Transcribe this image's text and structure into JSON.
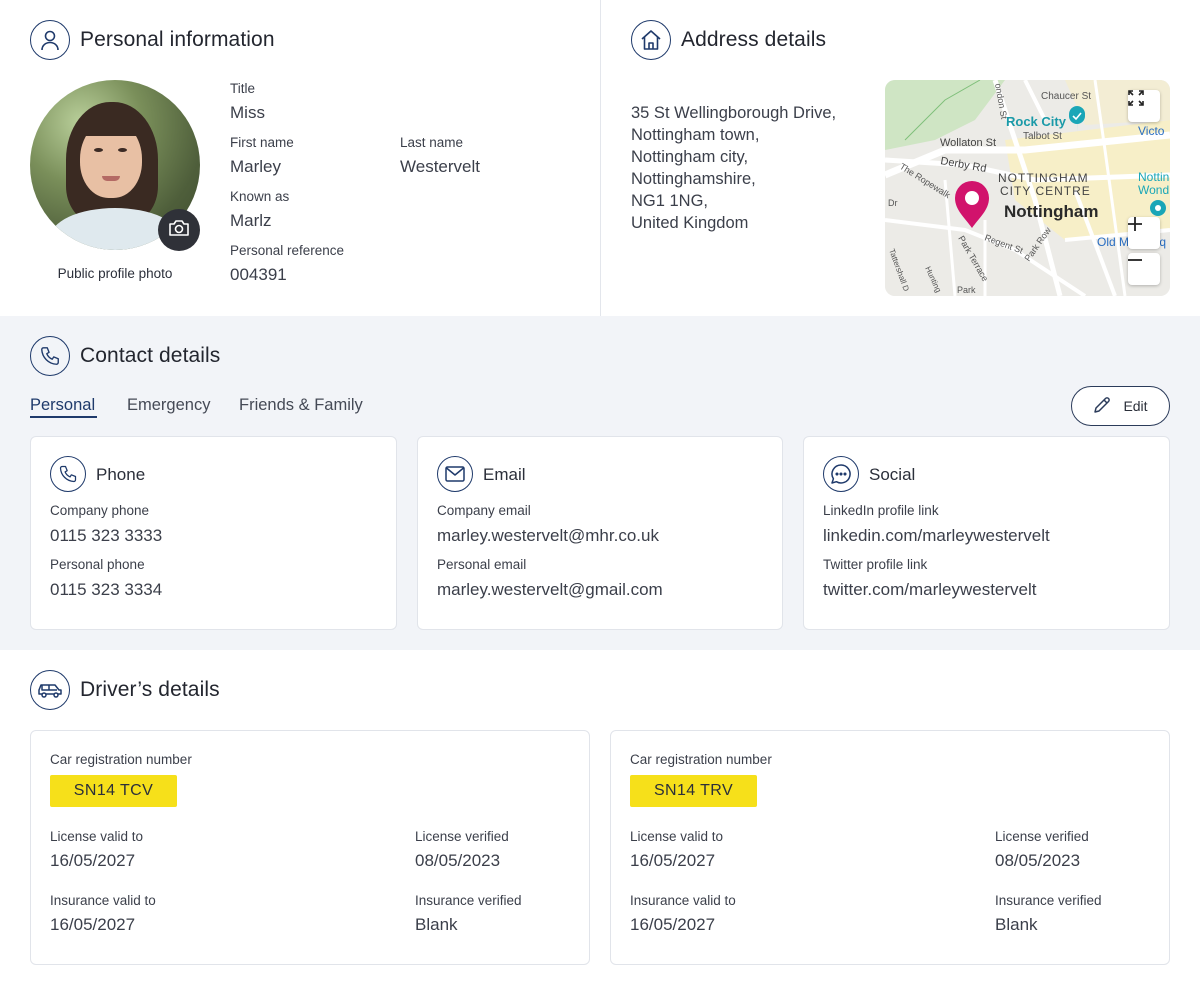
{
  "personal": {
    "title": "Personal information",
    "photo_caption": "Public profile photo",
    "fields": {
      "title_label": "Title",
      "title_value": "Miss",
      "first_label": "First name",
      "first_value": "Marley",
      "last_label": "Last name",
      "last_value": "Westervelt",
      "known_label": "Known as",
      "known_value": "Marlz",
      "ref_label": "Personal reference",
      "ref_value": "004391"
    }
  },
  "address": {
    "title": "Address details",
    "lines": [
      "35 St Wellingborough Drive,",
      "Nottingham town,",
      "Nottingham city,",
      "Nottinghamshire,",
      "NG1 1NG,",
      "United Kingdom"
    ],
    "map": {
      "labels": {
        "chaucer": "Chaucer St",
        "rock_city": "Rock City",
        "talbot": "Talbot St",
        "victoria": "Victo",
        "wollaton": "Wollaton St",
        "derby": "Derby Rd",
        "centre1": "NOTTINGHAM",
        "centre2": "CITY CENTRE",
        "nottingham": "Nottingham",
        "ropewalk": "The Ropewalk",
        "regent": "Regent St",
        "park_row": "Park Row",
        "park_terrace": "Park Terrace",
        "nott_wond1": "Nottin",
        "nott_wond2": "Wond",
        "old_market": "Old M",
        "market2": "et Sq",
        "tattershall": "Tattershall D",
        "hunting": "Hunting",
        "dr": "Dr",
        "park": "Park",
        "vertical_st": "ondon St"
      }
    }
  },
  "contact": {
    "title": "Contact details",
    "tabs": [
      "Personal",
      "Emergency",
      "Friends & Family"
    ],
    "edit_label": "Edit",
    "cards": {
      "phone": {
        "title": "Phone",
        "l1": "Company phone",
        "v1": "0115 323 3333",
        "l2": "Personal phone",
        "v2": "0115 323 3334"
      },
      "email": {
        "title": "Email",
        "l1": "Company email",
        "v1": "marley.westervelt@mhr.co.uk",
        "l2": "Personal email",
        "v2": "marley.westervelt@gmail.com"
      },
      "social": {
        "title": "Social",
        "l1": "LinkedIn profile link",
        "v1": "linkedin.com/marleywestervelt",
        "l2": "Twitter profile link",
        "v2": "twitter.com/marleywestervelt"
      }
    }
  },
  "driver": {
    "title": "Driver’s details",
    "cars": [
      {
        "reg_label": "Car registration number",
        "reg": "SN14 TCV",
        "license_valid_label": "License valid to",
        "license_valid": "16/05/2027",
        "license_verified_label": "License verified",
        "license_verified": "08/05/2023",
        "insurance_valid_label": "Insurance valid to",
        "insurance_valid": "16/05/2027",
        "insurance_verified_label": "Insurance verified",
        "insurance_verified": "Blank"
      },
      {
        "reg_label": "Car registration number",
        "reg": "SN14 TRV",
        "license_valid_label": "License valid to",
        "license_valid": "16/05/2027",
        "license_verified_label": "License verified",
        "license_verified": "08/05/2023",
        "insurance_valid_label": "Insurance valid to",
        "insurance_valid": "16/05/2027",
        "insurance_verified_label": "Insurance verified",
        "insurance_verified": "Blank"
      }
    ]
  },
  "colors": {
    "accent": "#1f3a6b",
    "section_bg": "#f2f4f8",
    "plate_yellow": "#f6e01a",
    "pin_magenta": "#d1136c",
    "map_teal": "#1aa6b7"
  }
}
